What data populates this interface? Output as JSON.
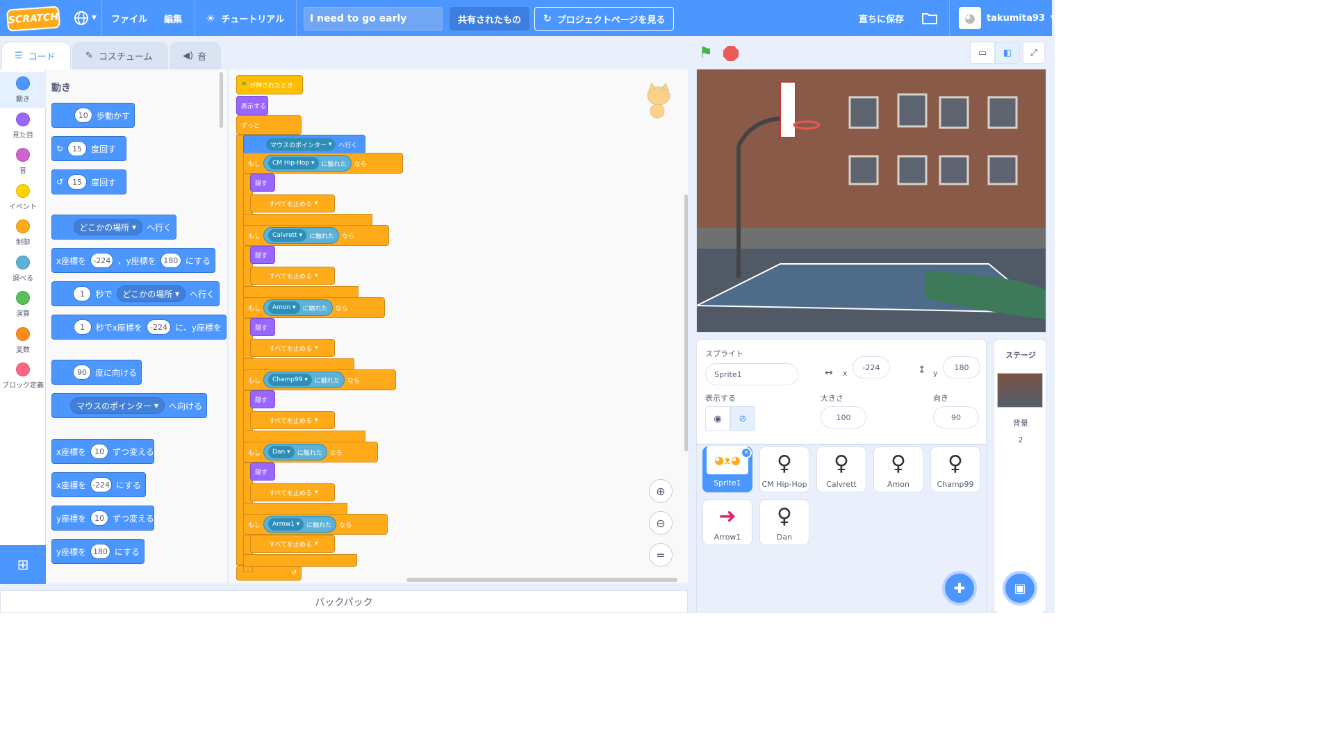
{
  "menubar": {
    "logo": "SCRATCH",
    "file": "ファイル",
    "edit": "編集",
    "tutorial": "チュートリアル",
    "project_title": "I need to go early",
    "shared": "共有されたもの",
    "project_page": "プロジェクトページを見る",
    "save_now": "直ちに保存",
    "username": "takumita93"
  },
  "tabs": {
    "code": "コード",
    "costume": "コスチューム",
    "sound": "音"
  },
  "categories": [
    "動き",
    "見た目",
    "音",
    "イベント",
    "制御",
    "調べる",
    "演算",
    "変数",
    "ブロック定義"
  ],
  "category_colors": [
    "#4c97ff",
    "#9966ff",
    "#cf63cf",
    "#ffd500",
    "#ffab19",
    "#5cb1d6",
    "#59c059",
    "#ff8c1a",
    "#ff6680"
  ],
  "palette": {
    "section": "動き",
    "b1": {
      "v": "10",
      "t": "歩動かす"
    },
    "b2": {
      "v": "15",
      "t": "度回す"
    },
    "b3": {
      "v": "15",
      "t": "度回す"
    },
    "b4": {
      "d": "どこかの場所",
      "t": "へ行く"
    },
    "b5": {
      "a": "x座標を",
      "x": "-224",
      "b": "、y座標を",
      "y": "180",
      "c": "にする"
    },
    "b6": {
      "v": "1",
      "a": "秒で",
      "d": "どこかの場所",
      "t": "へ行く"
    },
    "b7": {
      "v": "1",
      "a": "秒でx座標を",
      "x": "-224",
      "b": "に、y座標を"
    },
    "b8": {
      "v": "90",
      "t": "度に向ける"
    },
    "b9": {
      "d": "マウスのポインター",
      "t": "へ向ける"
    },
    "b10": {
      "a": "x座標を",
      "v": "10",
      "t": "ずつ変える"
    },
    "b11": {
      "a": "x座標を",
      "v": "-224",
      "t": "にする"
    },
    "b12": {
      "a": "y座標を",
      "v": "10",
      "t": "ずつ変える"
    },
    "b13": {
      "a": "y座標を",
      "v": "180",
      "t": "にする"
    }
  },
  "script": {
    "hat": "が押されたとき",
    "show": "表示する",
    "forever": "ずっと",
    "goto_target": "マウスのポインター",
    "goto": "へ行く",
    "if": "もし",
    "touching": "に触れた",
    "then": "なら",
    "hide": "隠す",
    "stop": "すべてを止める",
    "targets": [
      "CM Hip-Hop",
      "Calvrett",
      "Amon",
      "Champ99",
      "Dan",
      "Arrow1"
    ]
  },
  "backpack": "バックパック",
  "sprite_info": {
    "label": "スプライト",
    "name": "Sprite1",
    "x_label": "x",
    "x": "-224",
    "y_label": "y",
    "y": "180",
    "show_label": "表示する",
    "size_label": "大きさ",
    "size": "100",
    "dir_label": "向き",
    "dir": "90"
  },
  "sprites": [
    "Sprite1",
    "CM Hip-Hop",
    "Calvrett",
    "Amon",
    "Champ99",
    "Arrow1",
    "Dan"
  ],
  "stage_panel": {
    "title": "ステージ",
    "backdrop_label": "背景",
    "backdrop_count": "2"
  }
}
